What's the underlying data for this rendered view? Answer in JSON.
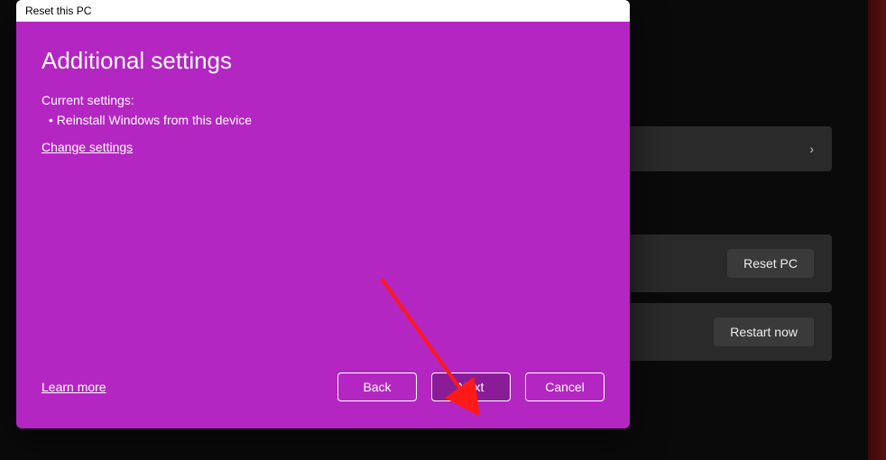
{
  "background": {
    "row1_chevron": "›",
    "reset_pc_label": "Reset PC",
    "restart_now_label": "Restart now"
  },
  "dialog": {
    "window_title": "Reset this PC",
    "heading": "Additional settings",
    "current_label": "Current settings:",
    "bullet_1": "Reinstall Windows from this device",
    "change_link": "Change settings",
    "learn_more": "Learn more",
    "back": "Back",
    "next": "Next",
    "cancel": "Cancel"
  }
}
